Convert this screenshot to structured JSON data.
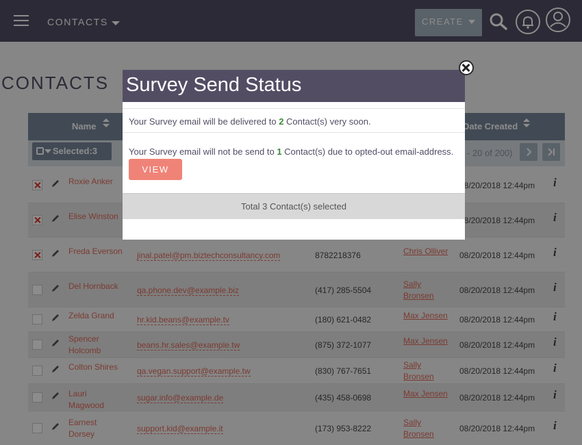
{
  "nav": {
    "module_label": "CONTACTS",
    "create_label": "CREATE"
  },
  "page": {
    "title": "CONTACTS"
  },
  "list": {
    "columns": {
      "name": "Name",
      "date_created": "Date Created"
    },
    "selected_label": "Selected:3",
    "pagination_text": "- 20 of 200)",
    "rows": [
      {
        "checked": true,
        "name": "Roxie Anker",
        "email": "",
        "phone": "",
        "user": "",
        "date": "08/20/2018 12:44pm"
      },
      {
        "checked": true,
        "name": "Elise Winston",
        "email": "",
        "phone": "",
        "user": "",
        "date": "08/20/2018 12:44pm"
      },
      {
        "checked": true,
        "name": "Freda Everson",
        "email": "jinal.patel@pm.biztechconsultancy.com",
        "phone": "8782218376",
        "user": "Chris Olliver",
        "date": "08/20/2018 12:44pm"
      },
      {
        "checked": false,
        "name": "Del Hornback",
        "email": "qa.phone.dev@example.biz",
        "phone": "(417) 285-5504",
        "user": "Sally Bronsen",
        "date": "08/20/2018 12:44pm"
      },
      {
        "checked": false,
        "name": "Zelda Grand",
        "email": "hr.kid.beans@example.tv",
        "phone": "(180) 621-0482",
        "user": "Max Jensen",
        "date": "08/20/2018 12:44pm"
      },
      {
        "checked": false,
        "name": "Spencer Holcomb",
        "email": "beans.hr.sales@example.tw",
        "phone": "(875) 372-1077",
        "user": "Max Jensen",
        "date": "08/20/2018 12:44pm"
      },
      {
        "checked": false,
        "name": "Colton Shires",
        "email": "qa.vegan.support@example.tw",
        "phone": "(830) 767-7651",
        "user": "Sally Bronsen",
        "date": "08/20/2018 12:44pm"
      },
      {
        "checked": false,
        "name": "Lauri Magwood",
        "email": "sugar.info@example.de",
        "phone": "(435) 458-0698",
        "user": "Max Jensen",
        "date": "08/20/2018 12:44pm"
      },
      {
        "checked": false,
        "name": "Earnest Dorsey",
        "email": "support.kid@example.it",
        "phone": "(173) 953-8222",
        "user": "Sally Bronsen",
        "date": "08/20/2018 12:44pm"
      }
    ]
  },
  "modal": {
    "title": "Survey Send Status",
    "line1_pre": "Your Survey email will be delivered to ",
    "line1_count": "2",
    "line1_post": " Contact(s) very soon.",
    "line2_pre": "Your Survey email will not be send to ",
    "line2_count": "1",
    "line2_post": " Contact(s) due to opted-out email-address.",
    "view_label": "VIEW",
    "total_text": "Total 3 Contact(s) selected"
  },
  "icons": {
    "menu": "hamburger-icon",
    "search": "search-icon",
    "notifications": "bell-icon",
    "profile": "user-icon",
    "close": "close-icon",
    "edit": "pencil-icon",
    "info": "info-icon"
  },
  "colors": {
    "nav": "#534d64",
    "accent": "#f08377",
    "header": "#778899",
    "link": "#e06a5a"
  }
}
